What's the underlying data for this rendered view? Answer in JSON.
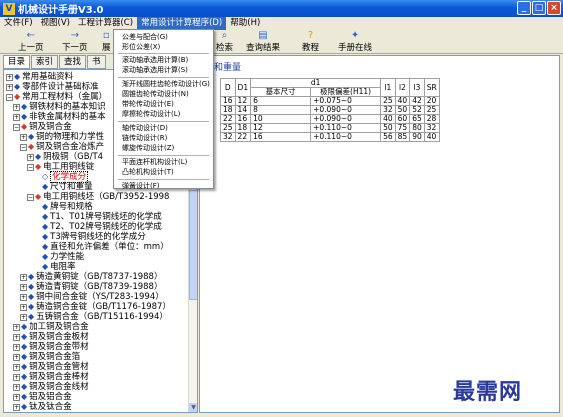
{
  "window": {
    "title": "机械设计手册V3.0",
    "app_icon": "V",
    "minimize": "_",
    "maximize": "□",
    "close": "×"
  },
  "menubar": {
    "items": [
      "文件(F)",
      "视图(V)",
      "工程计算器(C)",
      "常用设计计算程序(D)",
      "帮助(H)"
    ]
  },
  "toolbar": {
    "back": "上一页",
    "forward": "下一页",
    "expand": "展",
    "search": "检索",
    "results": "查询结果",
    "tutorial": "教程",
    "online": "手册在线",
    "help_symbol": "?"
  },
  "tabs": [
    "目录",
    "索引",
    "查找",
    "书"
  ],
  "dropdown": {
    "items": [
      "公差与配合(G)",
      "形位公差(X)",
      "滚动轴承选用计算(B)",
      "滚动轴承选用计算(S)",
      "渐开线圆柱齿轮传动设计(G)",
      "圆锥齿轮传动设计(N)",
      "带轮传动设计(E)",
      "摩擦轮传动设计(L)",
      "轴传动设计(D)",
      "链传动设计(R)",
      "螺旋传动设计(Z)",
      "平面连杆机构设计(L)",
      "凸轮机构设计(T)",
      "弹簧设计(F)"
    ]
  },
  "tree": {
    "nodes": [
      {
        "text": "常用基础资料",
        "level": 0,
        "exp": "+"
      },
      {
        "text": "零部件设计基础标准",
        "level": 0,
        "exp": "+"
      },
      {
        "text": "常用工程材料（金属）",
        "level": 0,
        "exp": "−"
      },
      {
        "text": "钢铁材料的基本知识",
        "level": 1,
        "exp": "+"
      },
      {
        "text": "非铁金属材料的基本",
        "level": 1,
        "exp": "+"
      },
      {
        "text": "铜及铜合金",
        "level": 1,
        "exp": "−"
      },
      {
        "text": "铜的物理和力学性",
        "level": 2,
        "exp": "+"
      },
      {
        "text": "铜及铜合金冶炼产",
        "level": 2,
        "exp": "−"
      },
      {
        "text": "阴极铜（GB/T4",
        "level": 3,
        "exp": "+"
      },
      {
        "text": "电工用铜线锭",
        "level": 3,
        "exp": "−"
      },
      {
        "text": "化学成分",
        "level": 4,
        "exp": "",
        "sel": true
      },
      {
        "text": "尺寸和重量",
        "level": 4,
        "exp": ""
      },
      {
        "text": "电工用铜线坯（GB/T3952-1998",
        "level": 3,
        "exp": "−"
      },
      {
        "text": "牌号和规格",
        "level": 4,
        "exp": ""
      },
      {
        "text": "T1、T01牌号铜线坯的化学成",
        "level": 4,
        "exp": ""
      },
      {
        "text": "T2、T02牌号铜线坯的化学成",
        "level": 4,
        "exp": ""
      },
      {
        "text": "T3牌号铜线坯的化学成分",
        "level": 4,
        "exp": ""
      },
      {
        "text": "直径和允许偏差（单位：mm）",
        "level": 4,
        "exp": ""
      },
      {
        "text": "力学性能",
        "level": 4,
        "exp": ""
      },
      {
        "text": "电阻率",
        "level": 4,
        "exp": ""
      },
      {
        "text": "铸造黄铜锭（GB/T8737-1988）",
        "level": 2,
        "exp": "+"
      },
      {
        "text": "铸造青铜锭（GB/T8739-1988）",
        "level": 2,
        "exp": "+"
      },
      {
        "text": "铜中间合金锭（YS/T283-1994）",
        "level": 2,
        "exp": "+"
      },
      {
        "text": "铸造铜合金锭（GB/T1176-1987）",
        "level": 2,
        "exp": "+"
      },
      {
        "text": "五铸铜合金（GB/T15116-1994）",
        "level": 2,
        "exp": "+"
      },
      {
        "text": "加工铜及铜合金",
        "level": 1,
        "exp": "+"
      },
      {
        "text": "铜及铜合金板材",
        "level": 1,
        "exp": "+"
      },
      {
        "text": "铜及铜合金带材",
        "level": 1,
        "exp": "+"
      },
      {
        "text": "铜及铜合金箔",
        "level": 1,
        "exp": "+"
      },
      {
        "text": "铜及铜合金管材",
        "level": 1,
        "exp": "+"
      },
      {
        "text": "铜及铜合金棒材",
        "level": 1,
        "exp": "+"
      },
      {
        "text": "铜及铜合金线材",
        "level": 1,
        "exp": "+"
      },
      {
        "text": "铝及铝合金",
        "level": 1,
        "exp": "+"
      },
      {
        "text": "钛及钛合金",
        "level": 1,
        "exp": "+"
      }
    ]
  },
  "content": {
    "heading": "和重量",
    "table": {
      "header_top": [
        "D",
        "D1",
        "d1",
        "l1",
        "l2",
        "l3",
        "SR"
      ],
      "header_sub": [
        "基本尺寸",
        "极限偏差(H11)"
      ],
      "rows": [
        [
          "16",
          "12",
          "6",
          "+0.075~0",
          "25",
          "40",
          "42",
          "20"
        ],
        [
          "18",
          "14",
          "8",
          "+0.090~0",
          "32",
          "50",
          "52",
          "25"
        ],
        [
          "22",
          "16",
          "10",
          "+0.090~0",
          "40",
          "60",
          "65",
          "28"
        ],
        [
          "25",
          "18",
          "12",
          "+0.110~0",
          "50",
          "75",
          "80",
          "32"
        ],
        [
          "32",
          "22",
          "16",
          "+0.110~0",
          "56",
          "85",
          "90",
          "40"
        ]
      ]
    }
  },
  "watermark": "最需网"
}
